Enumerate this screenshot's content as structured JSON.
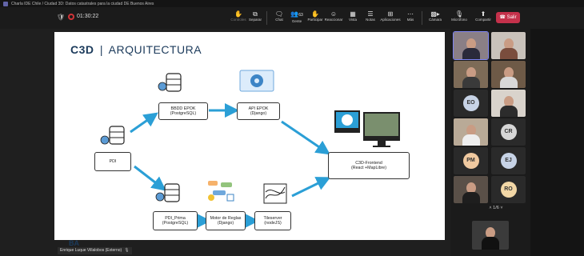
{
  "window": {
    "title": "Charla IDE Chile / Ciudad 3D: Datos catastrales para la ciudad DE Buenos Aires"
  },
  "meeting": {
    "timer": "01:30:22"
  },
  "toolbar": {
    "controls_label": "Controles",
    "share_label": "Separar",
    "chat_label": "Chat",
    "people_label": "Gente",
    "people_count": "63",
    "raise_label": "Participar",
    "react_label": "Reaccionar",
    "view_label": "Vista",
    "notes_label": "Notas",
    "apps_label": "Aplicaciones",
    "more_label": "Más",
    "camera_label": "Cámara",
    "mic_label": "Micrófono",
    "share_screen_label": "Compartir",
    "leave_label": "Salir",
    "leave_color": "#c4314b"
  },
  "slide": {
    "brand": "C3D",
    "title": "ARQUITECTURA",
    "nodes": {
      "pdi": {
        "line1": "PDI"
      },
      "bbdd": {
        "line1": "BBDD EPOK",
        "line2": "(PostgreSQL)"
      },
      "api": {
        "line1": "API EPOK",
        "line2": "(Django)"
      },
      "frontend": {
        "line1": "C3D-Frontend",
        "line2": "(React +MapLibre)"
      },
      "pdi_prima": {
        "line1": "PDI_Prima",
        "line2": "(PostgreSQL)"
      },
      "motor": {
        "line1": "Motor de Reglas",
        "line2": "(Django)"
      },
      "tileserver": {
        "line1": "Tileserver",
        "line2": "(nodeJS)"
      }
    },
    "logo_text": "BA",
    "accent_color": "#2b9fd6",
    "title_color": "#1b3a5b"
  },
  "presenter": {
    "name": "Enrique Luque Villalobos (Externo)"
  },
  "participants": {
    "initials": [
      "EO",
      "CR",
      "PM",
      "EJ",
      "RO"
    ],
    "page": "1/6"
  }
}
